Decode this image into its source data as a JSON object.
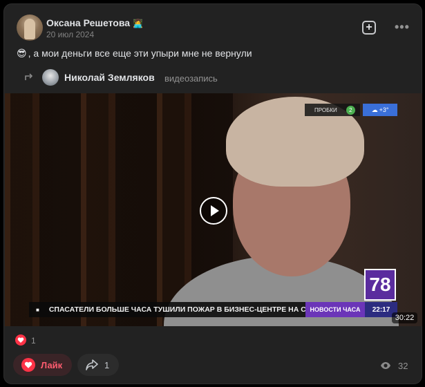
{
  "post": {
    "author_name": "Оксана Решетова",
    "author_badge_icon": "emoji-badge-icon",
    "author_badge": "👩‍💻",
    "date": "20 июл 2024",
    "text_emoji": "😎",
    "text": ", а мои деньги все еще эти упыри мне не вернули"
  },
  "repost": {
    "name": "Николай Земляков",
    "type": "видеозапись"
  },
  "video": {
    "traffic_label": "ПРОБКИ",
    "traffic_level": "2",
    "weather": "+3°",
    "channel_logo": "78",
    "ticker_text": "СПАСАТЕЛИ БОЛЬШЕ ЧАСА ТУШИЛИ ПОЖАР В БИЗНЕС-ЦЕНТРЕ НА СЕД",
    "news_label": "НОВОСТИ ЧАСА",
    "news_time": "22:17",
    "duration": "30:22"
  },
  "reactions": {
    "count": "1"
  },
  "actions": {
    "like_label": "Лайк",
    "share_count": "1",
    "views_count": "32"
  },
  "colors": {
    "card_bg": "#222222",
    "like_red": "#ff3347",
    "weather_blue": "#3a6fd8",
    "channel_purple": "#6b35b8"
  }
}
